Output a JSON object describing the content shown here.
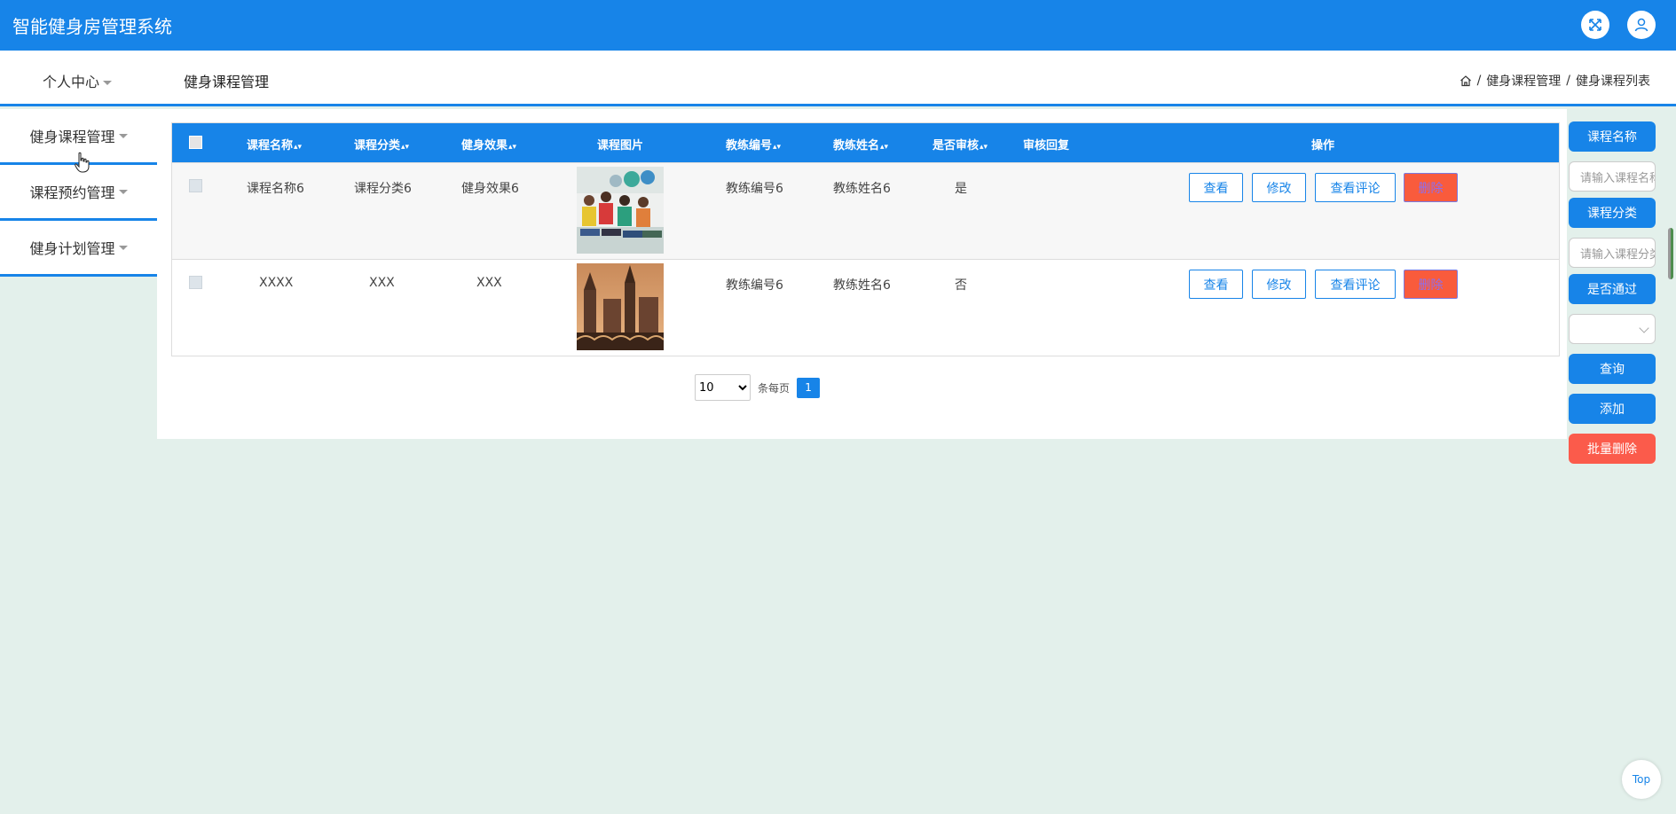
{
  "app": {
    "title": "智能健身房管理系统"
  },
  "header": {
    "personal_center": "个人中心",
    "page_title": "健身课程管理"
  },
  "breadcrumb": {
    "items": [
      "健身课程管理",
      "健身课程列表"
    ],
    "separator": "/"
  },
  "sidebar": {
    "items": [
      {
        "label": "健身课程管理"
      },
      {
        "label": "课程预约管理"
      },
      {
        "label": "健身计划管理"
      }
    ]
  },
  "table": {
    "columns": [
      "课程名称",
      "课程分类",
      "健身效果",
      "课程图片",
      "教练编号",
      "教练姓名",
      "是否审核",
      "审核回复",
      "操作"
    ],
    "rows": [
      {
        "course_name": "课程名称6",
        "category": "课程分类6",
        "effect": "健身效果6",
        "coach_no": "教练编号6",
        "coach_name": "教练姓名6",
        "reviewed": "是",
        "reply": ""
      },
      {
        "course_name": "XXXX",
        "category": "XXX",
        "effect": "XXX",
        "coach_no": "教练编号6",
        "coach_name": "教练姓名6",
        "reviewed": "否",
        "reply": ""
      }
    ],
    "actions": {
      "view": "查看",
      "edit": "修改",
      "view_comments": "查看评论",
      "delete": "删除"
    }
  },
  "pagination": {
    "page_size": "10",
    "per_page_label": "条每页",
    "current_page": "1"
  },
  "search": {
    "course_name_label": "课程名称",
    "course_name_placeholder": "请输入课程名称",
    "category_label": "课程分类",
    "category_placeholder": "请输入课程分类",
    "approved_label": "是否通过",
    "query": "查询",
    "add": "添加",
    "batch_delete": "批量删除"
  },
  "back_to_top": "Top",
  "colors": {
    "primary": "#1784e8",
    "danger": "#fb5b4b",
    "background": "#e3f0eb"
  }
}
